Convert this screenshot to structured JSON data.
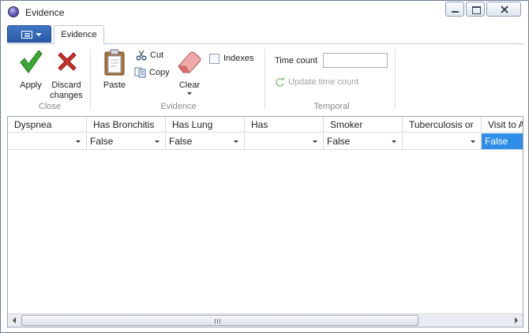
{
  "window": {
    "title": "Evidence"
  },
  "ribbon": {
    "tab_label": "Evidence",
    "close_group": {
      "label": "Close",
      "apply": "Apply",
      "discard": "Discard changes"
    },
    "evidence_group": {
      "label": "Evidence",
      "paste": "Paste",
      "cut": "Cut",
      "copy": "Copy",
      "clear": "Clear",
      "indexes": "Indexes",
      "indexes_checked": false
    },
    "temporal_group": {
      "label": "Temporal",
      "time_count_label": "Time count",
      "time_count_value": "",
      "update_label": "Update time count"
    }
  },
  "grid": {
    "columns": [
      "Dyspnea",
      "Has Bronchitis",
      "Has Lung",
      "Has",
      "Smoker",
      "Tuberculosis or",
      "Visit to A"
    ],
    "row": [
      "",
      "False",
      "False",
      "",
      "False",
      "",
      "False"
    ],
    "selected_column": 6
  },
  "icons": {
    "app_menu": "app-menu-icon",
    "apply": "checkmark-icon",
    "discard": "red-x-icon",
    "paste": "clipboard-icon",
    "cut": "scissors-icon",
    "copy": "copy-icon",
    "clear": "eraser-icon",
    "update": "refresh-icon"
  },
  "colors": {
    "selection": "#2f8fe8",
    "apply_green": "#3aa832",
    "discard_red": "#c9312b",
    "app_button": "#2f63b5"
  }
}
